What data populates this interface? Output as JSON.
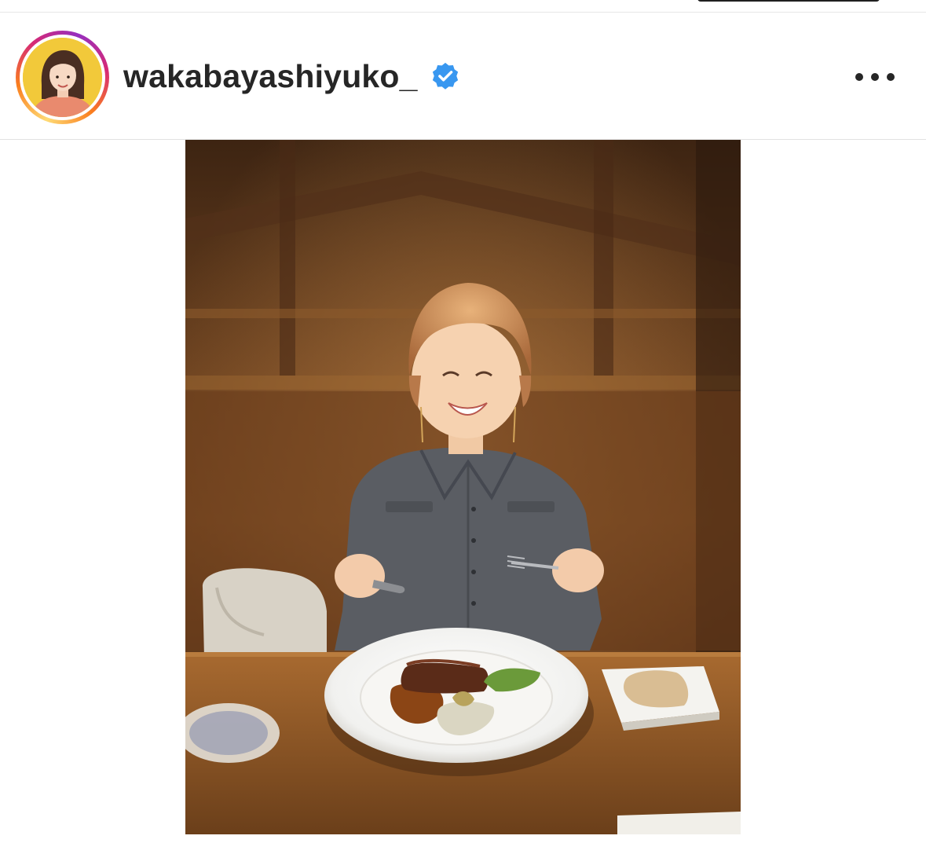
{
  "post": {
    "username": "wakabayashiyuko_",
    "verified": true,
    "more_icon": "more-horizontal-icon",
    "verified_icon": "verified-badge-icon"
  },
  "colors": {
    "verified_blue": "#3897f0",
    "text": "#262626",
    "avatar_bg": "#f2c93a",
    "story_ring": [
      "#feda75",
      "#fa7e1e",
      "#d62976",
      "#962fbf"
    ]
  },
  "photo": {
    "subject": "woman smiling at restaurant table with steak dinner plate"
  }
}
